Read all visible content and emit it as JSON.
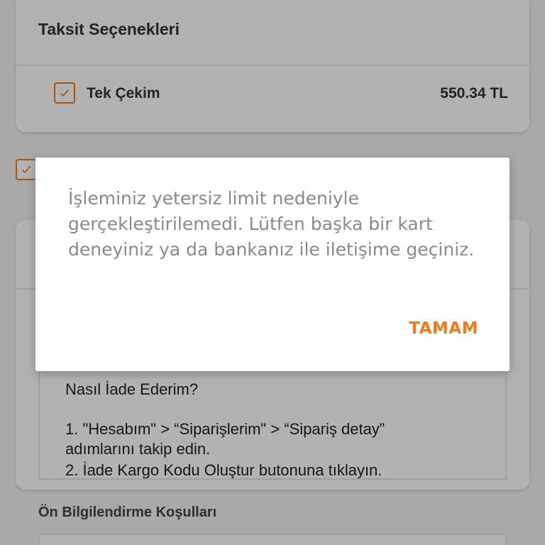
{
  "installments": {
    "title": "Taksit Seçenekleri",
    "option": {
      "label": "Tek Çekim",
      "price": "550.34 TL",
      "checked": true
    }
  },
  "agreement": {
    "checked": true
  },
  "return_info": {
    "title": "Nasıl İade Ederim?",
    "step1_line1": "1. \"Hesabım\" > “Siparişlerim\" > “Sipariş detay”",
    "step1_line2": "adımlarını takip edin.",
    "step2": "2. İade Kargo Kodu Oluştur butonuna tıklayın."
  },
  "pre_info": {
    "label": "Ön Bilgilendirme Koşulları"
  },
  "dialog": {
    "message": "İşleminiz yetersiz limit nedeniyle gerçekleştirilemedi. Lütfen başka bir kart deneyiniz ya da bankanız ile iletişime geçiniz.",
    "ok_label": "TAMAM"
  },
  "colors": {
    "accent": "#f27a1a",
    "scrim": "rgba(0,0,0,0.30)"
  },
  "icons": {
    "checkbox": "check-icon"
  }
}
